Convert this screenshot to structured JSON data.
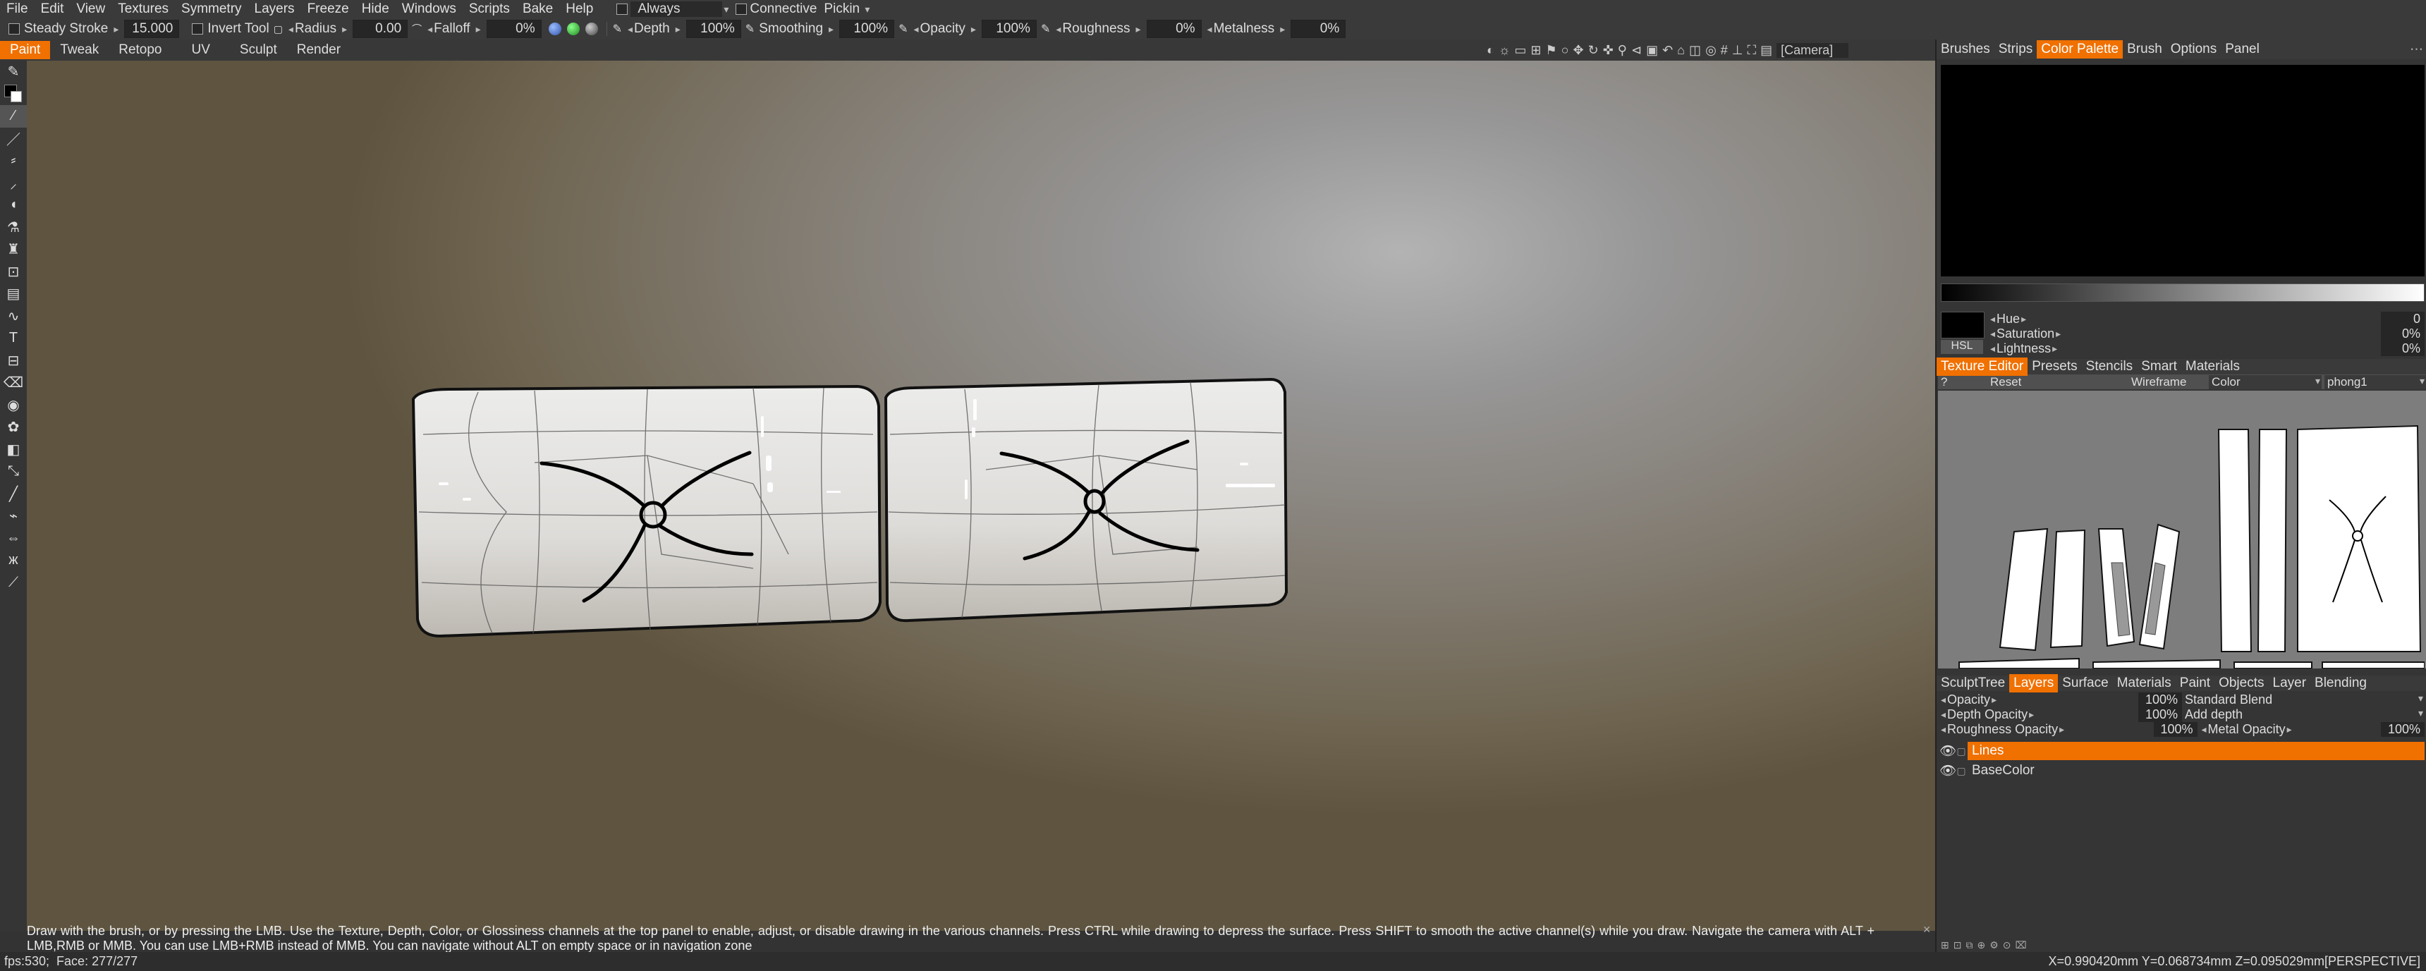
{
  "menubar": {
    "items": [
      "File",
      "Edit",
      "View",
      "Textures",
      "Symmetry",
      "Layers",
      "Freeze",
      "Hide",
      "Windows",
      "Scripts",
      "Bake",
      "Help"
    ],
    "always_label": "Always",
    "connective_label": "Connective",
    "pickin_label": "Pickin"
  },
  "toolbar": {
    "steady_stroke_label": "Steady Stroke",
    "steady_stroke_value": "15.000",
    "invert_tool_label": "Invert Tool",
    "radius_label": "Radius",
    "radius_value": "0.00",
    "falloff_label": "Falloff",
    "falloff_value": "0%",
    "depth_label": "Depth",
    "depth_value": "100%",
    "smoothing_label": "Smoothing",
    "smoothing_value": "100%",
    "opacity_label": "Opacity",
    "opacity_value": "100%",
    "roughness_label": "Roughness",
    "roughness_value": "0%",
    "metalness_label": "Metalness",
    "metalness_value": "0%"
  },
  "modebar": {
    "tabs": [
      "Paint",
      "Tweak",
      "Retopo",
      "UV",
      "Sculpt",
      "Render"
    ],
    "active_tab": "Paint",
    "camera_label": "[Camera]"
  },
  "right_panel": {
    "top_tabs": [
      "Brushes",
      "Strips",
      "Color Palette",
      "Brush",
      "Options",
      "Panel"
    ],
    "active_top_tab": "Color Palette",
    "hue_label": "Hue",
    "hue_value": "0",
    "saturation_label": "Saturation",
    "saturation_value": "0%",
    "lightness_label": "Lightness",
    "lightness_value": "0%",
    "hsl_button": "HSL",
    "texture_tabs": [
      "Texture Editor",
      "Presets",
      "Stencils",
      "Smart",
      "Materials"
    ],
    "active_texture_tab": "Texture Editor",
    "texture_toolbar": {
      "help": "?",
      "reset": "Reset",
      "wireframe": "Wireframe",
      "channel": "Color",
      "material": "phong1"
    },
    "layer_tabs": [
      "SculptTree",
      "Layers",
      "Surface",
      "Materials",
      "Paint",
      "Objects",
      "Layer",
      "Blending"
    ],
    "active_layer_tab": "Layers",
    "layer_props": {
      "opacity_label": "Opacity",
      "opacity_value": "100%",
      "blend_mode": "Standard Blend",
      "depth_opacity_label": "Depth Opacity",
      "depth_opacity_value": "100%",
      "depth_mode": "Add depth",
      "roughness_opacity_label": "Roughness Opacity",
      "roughness_opacity_value": "100%",
      "metal_opacity_label": "Metal Opacity",
      "metal_opacity_value": "100%"
    },
    "layers": [
      {
        "name": "Lines",
        "selected": true
      },
      {
        "name": "BaseColor",
        "selected": false
      }
    ]
  },
  "hint": "Draw with the brush, or by pressing the LMB. Use the Texture, Depth, Color, or Glossiness channels at the top panel to enable, adjust, or disable drawing in the various channels. Press CTRL while drawing to depress the surface. Press SHIFT to smooth the active channel(s) while you draw. Navigate the camera with ALT + LMB,RMB or MMB. You can use LMB+RMB instead of MMB. You can navigate without ALT on empty space or in navigation zone",
  "status": {
    "left": "fps:530;  Face: 277/277",
    "right": "X=0.990420mm  Y=0.068734mm  Z=0.095029mm[PERSPECTIVE]"
  },
  "colors": {
    "accent": "#f07000",
    "panel": "#353535",
    "viewport_light": "#b3b3b3",
    "viewport_dark": "#5e5440"
  }
}
